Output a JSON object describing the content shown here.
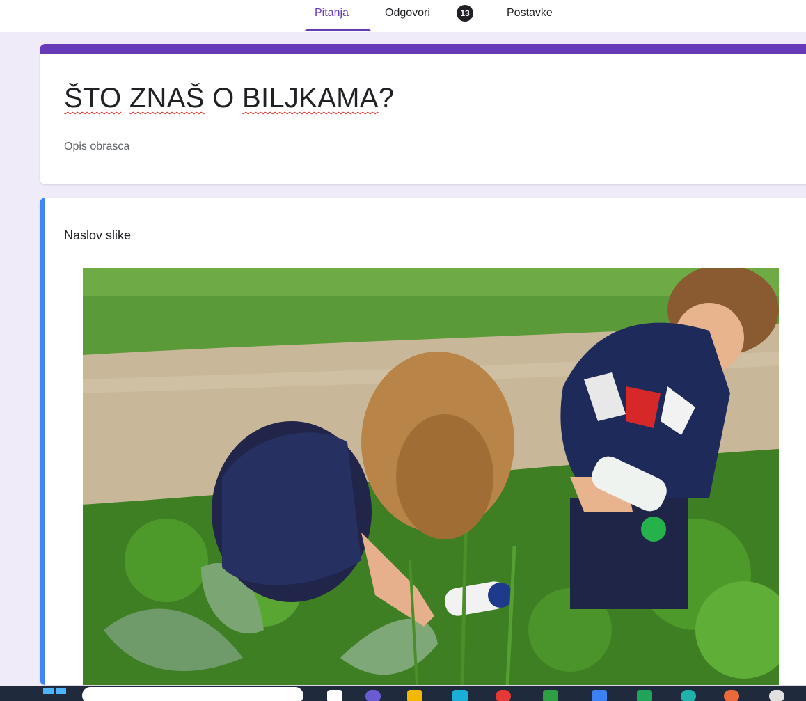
{
  "tabs": {
    "questions": "Pitanja",
    "responses": "Odgovori",
    "responses_count": "13",
    "settings": "Postavke"
  },
  "form": {
    "title_part1": "ŠTO",
    "title_part2": "ZNAŠ",
    "title_part3": "O",
    "title_part4": "BILJKAMA",
    "title_part5": "?",
    "description_placeholder": "Opis obrasca"
  },
  "image_item": {
    "title": "Naslov slike"
  },
  "colors": {
    "accent": "#673ab7",
    "image_item_bar": "#4285f4",
    "page_bg": "#f0ebf8"
  }
}
